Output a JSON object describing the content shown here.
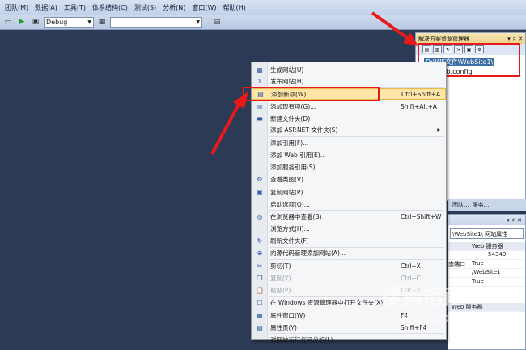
{
  "menubar": {
    "items": [
      "团队(M)",
      "数据(A)",
      "工具(T)",
      "体系结构(C)",
      "测试(S)",
      "分析(N)",
      "窗口(W)",
      "帮助(H)"
    ]
  },
  "toolbar": {
    "config": "Debug",
    "search_value": ""
  },
  "solution_explorer": {
    "title": "解决方案资源管理器",
    "controls": [
      "▾",
      "♯",
      "✕"
    ],
    "tree": [
      "D:\\WF文件\\WebSite1\\",
      "web.config"
    ]
  },
  "lower_tabs": [
    "团队...",
    "服务..."
  ],
  "properties": {
    "controls": [
      "▾",
      "♯",
      "✕"
    ],
    "object": "\\WebSite1\\ 网站属性",
    "rows": [
      {
        "key": "",
        "value": "Web 服务器"
      },
      {
        "key": "",
        "value": "54349"
      },
      {
        "key": "态端口",
        "value": "True"
      },
      {
        "key": "",
        "value": "/WebSite1"
      },
      {
        "key": "",
        "value": "True"
      }
    ],
    "footer": "Web 服务器"
  },
  "context_menu": {
    "items": [
      {
        "label": "生成网站(U)",
        "shortcut": "",
        "icon": "build-icon",
        "glyph": "▦",
        "disabled": false,
        "submenu": false
      },
      {
        "label": "发布网站(H)",
        "shortcut": "",
        "icon": "publish-icon",
        "glyph": "⇪",
        "disabled": false,
        "submenu": false
      },
      {
        "label": "添加新项(W)...",
        "shortcut": "Ctrl+Shift+A",
        "icon": "add-new-item-icon",
        "glyph": "▤",
        "disabled": false,
        "submenu": false,
        "highlighted": true
      },
      {
        "label": "添加现有项(G)...",
        "shortcut": "Shift+Alt+A",
        "icon": "add-existing-item-icon",
        "glyph": "▥",
        "disabled": false,
        "submenu": false
      },
      {
        "label": "新建文件夹(D)",
        "shortcut": "",
        "icon": "new-folder-icon",
        "glyph": "▬",
        "disabled": false,
        "submenu": false
      },
      {
        "label": "添加 ASP.NET 文件夹(S)",
        "shortcut": "",
        "icon": "",
        "glyph": "",
        "disabled": false,
        "submenu": true
      },
      {
        "label": "添加引用(F)...",
        "shortcut": "",
        "icon": "",
        "glyph": "",
        "disabled": false,
        "submenu": false
      },
      {
        "label": "添加 Web 引用(E)...",
        "shortcut": "",
        "icon": "",
        "glyph": "",
        "disabled": false,
        "submenu": false
      },
      {
        "label": "添加服务引用(S)...",
        "shortcut": "",
        "icon": "",
        "glyph": "",
        "disabled": false,
        "submenu": false
      },
      {
        "label": "查看类图(V)",
        "shortcut": "",
        "icon": "class-diagram-icon",
        "glyph": "⚙",
        "disabled": false,
        "submenu": false
      },
      {
        "label": "复制网站(P)...",
        "shortcut": "",
        "icon": "copy-website-icon",
        "glyph": "▣",
        "disabled": false,
        "submenu": false
      },
      {
        "label": "启动选项(O)...",
        "shortcut": "",
        "icon": "",
        "glyph": "",
        "disabled": false,
        "submenu": false
      },
      {
        "label": "在浏览器中查看(B)",
        "shortcut": "Ctrl+Shift+W",
        "icon": "browser-view-icon",
        "glyph": "◎",
        "disabled": false,
        "submenu": false
      },
      {
        "label": "浏览方式(H)...",
        "shortcut": "",
        "icon": "",
        "glyph": "",
        "disabled": false,
        "submenu": false
      },
      {
        "label": "刷新文件夹(F)",
        "shortcut": "",
        "icon": "refresh-icon",
        "glyph": "↻",
        "disabled": false,
        "submenu": false
      },
      {
        "label": "向源代码管理添加网站(A)...",
        "shortcut": "",
        "icon": "source-control-icon",
        "glyph": "⊕",
        "disabled": false,
        "submenu": false
      },
      {
        "label": "剪切(T)",
        "shortcut": "Ctrl+X",
        "icon": "cut-icon",
        "glyph": "✂",
        "disabled": false,
        "submenu": false
      },
      {
        "label": "复制(Y)",
        "shortcut": "Ctrl+C",
        "icon": "copy-icon",
        "glyph": "❐",
        "disabled": true,
        "submenu": false
      },
      {
        "label": "粘贴(P)",
        "shortcut": "Ctrl+V",
        "icon": "paste-icon",
        "glyph": "📋",
        "disabled": true,
        "submenu": false
      },
      {
        "label": "在 Windows 资源管理器中打开文件夹(X)",
        "shortcut": "",
        "icon": "explorer-icon",
        "glyph": "☐",
        "disabled": false,
        "submenu": false
      },
      {
        "label": "属性窗口(W)",
        "shortcut": "F4",
        "icon": "properties-window-icon",
        "glyph": "▦",
        "disabled": false,
        "submenu": false
      },
      {
        "label": "属性页(Y)",
        "shortcut": "Shift+F4",
        "icon": "property-pages-icon",
        "glyph": "▤",
        "disabled": false,
        "submenu": false
      },
      {
        "label": "对网站运行代码分析(L)",
        "shortcut": "",
        "icon": "",
        "glyph": "",
        "disabled": false,
        "submenu": false
      }
    ]
  },
  "watermark": {
    "brand": "搜狗指南",
    "url": "zhinan.sogou.com"
  },
  "colors": {
    "accent_red": "#e8191b",
    "highlight": "#ffe6a8",
    "workspace": "#2b3a55"
  }
}
